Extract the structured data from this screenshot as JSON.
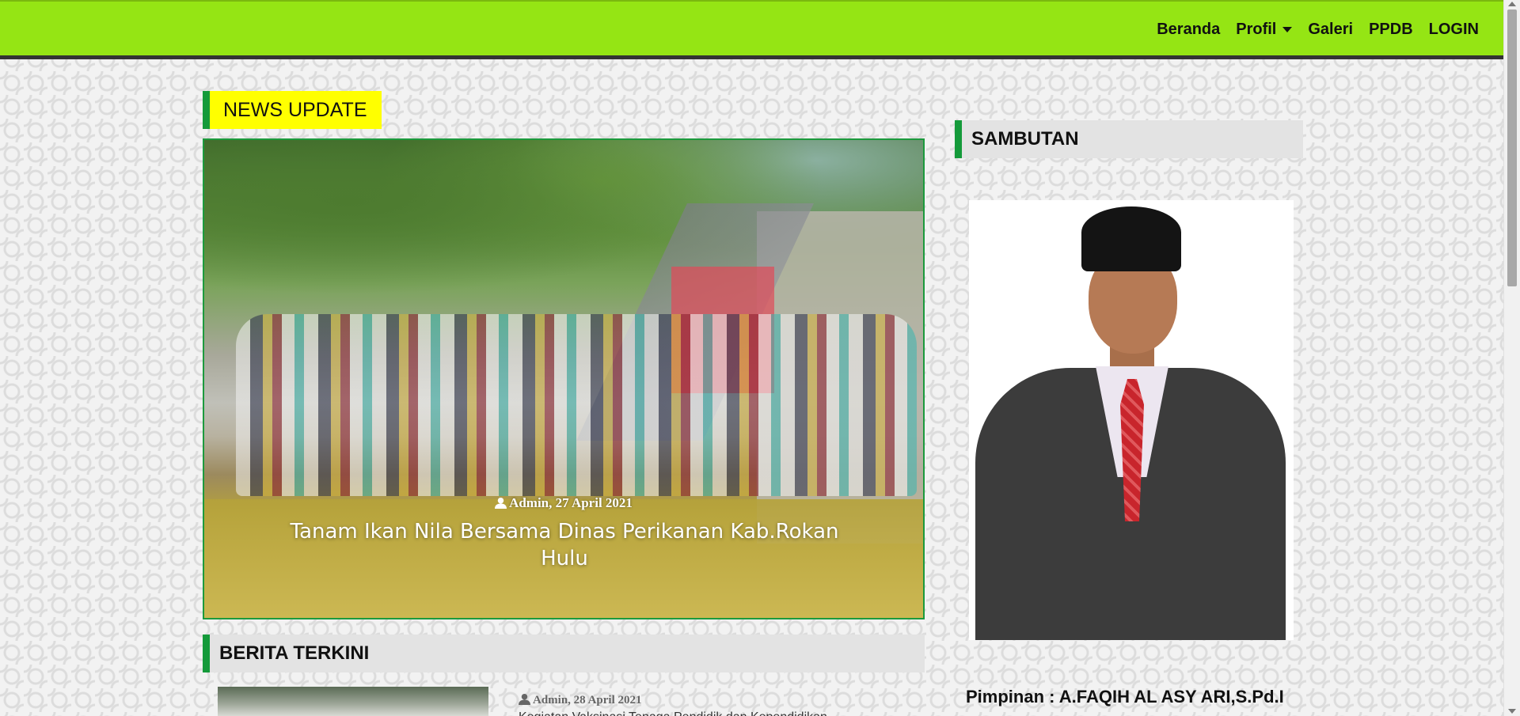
{
  "nav": {
    "items": [
      {
        "label": "Beranda"
      },
      {
        "label": "Profil"
      },
      {
        "label": "Galeri"
      },
      {
        "label": "PPDB"
      },
      {
        "label": "LOGIN"
      }
    ]
  },
  "news_update": {
    "label": "NEWS UPDATE",
    "slide": {
      "meta": "Admin, 27 April 2021",
      "title": "Tanam Ikan Nila Bersama Dinas Perikanan Kab.Rokan Hulu"
    }
  },
  "berita": {
    "header": "BERITA TERKINI",
    "items": [
      {
        "meta": "Admin, 28 April 2021",
        "title": "Kegiatan Vaksinasi Tenaga Pendidik dan Kependidikan"
      }
    ]
  },
  "sambutan": {
    "header": "SAMBUTAN",
    "pimpinan": "Pimpinan : A.FAQIH AL ASY ARI,S.Pd.I"
  },
  "colors": {
    "navbar": "#95e514",
    "accent_green": "#149a3a",
    "news_label_bg": "#ffff00"
  }
}
